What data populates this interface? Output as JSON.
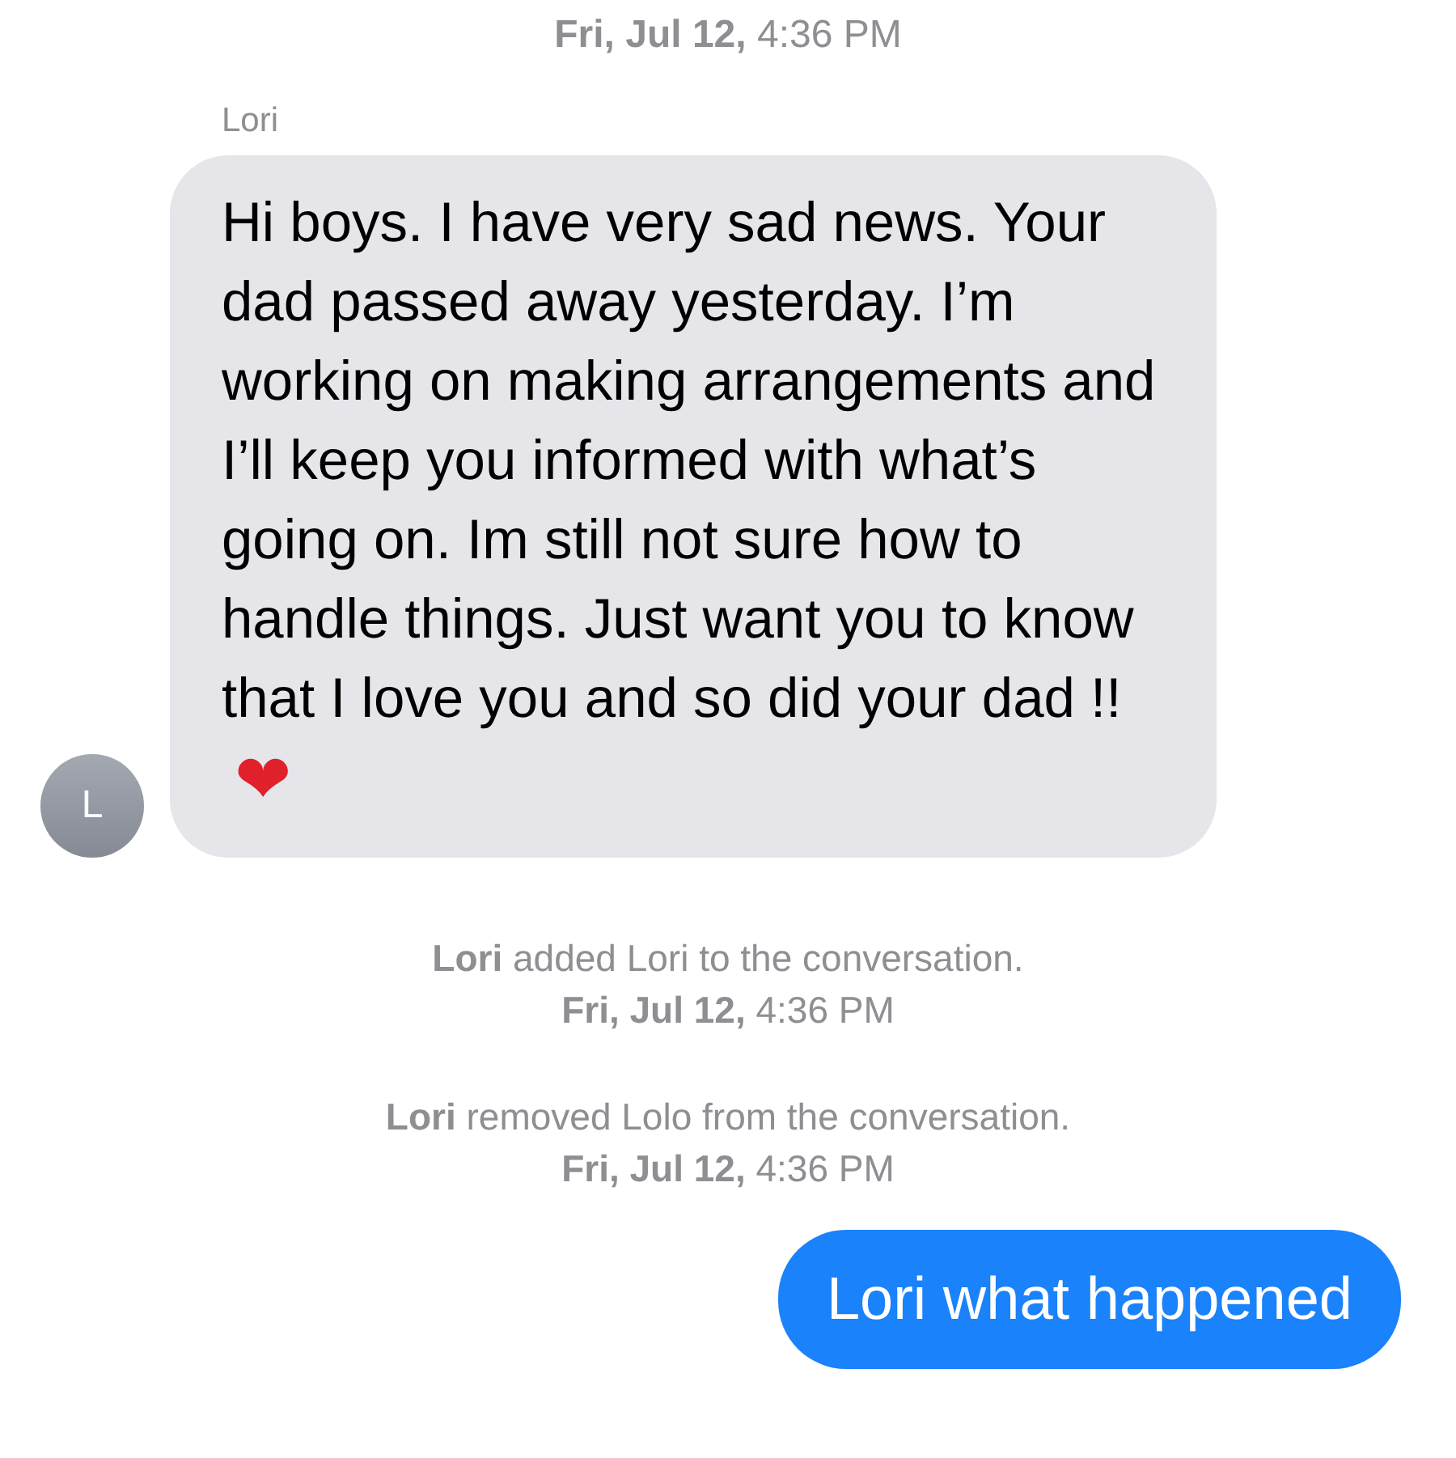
{
  "timestamp": "**Fri, Jul 12,** 4:36 PM",
  "incoming": {
    "sender": "Lori",
    "avatar": "L",
    "text": "Hi boys. I have very sad news. Your dad passed away yesterday. I’m working on making arrangements and I’ll keep you informed with what’s going on. Im still not sure how to handle things. Just want you to know that I love you and so did your dad !!",
    "emoji": "❤"
  },
  "events": [
    {
      "text": "**Lori** added Lori to the conversation.",
      "time": "**Fri, Jul 12,** 4:36 PM"
    },
    {
      "text": "**Lori** removed Lolo from the conversation.",
      "time": "**Fri, Jul 12,** 4:36 PM"
    }
  ],
  "outgoing": {
    "text": "Lori what happened"
  }
}
